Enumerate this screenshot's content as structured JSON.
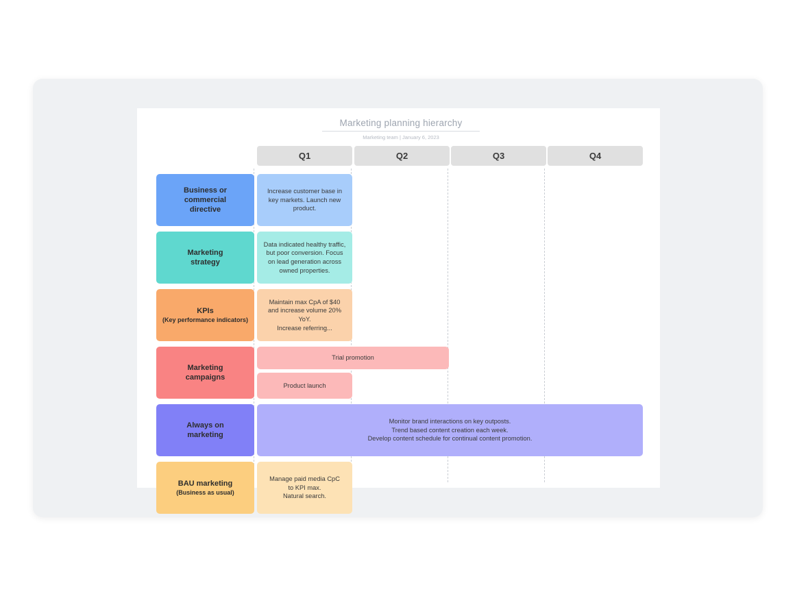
{
  "document": {
    "title": "Marketing planning hierarchy",
    "subtitle": "Marketing team  |  January 6, 2023"
  },
  "columns": [
    {
      "id": "q1",
      "label": "Q1"
    },
    {
      "id": "q2",
      "label": "Q2"
    },
    {
      "id": "q3",
      "label": "Q3"
    },
    {
      "id": "q4",
      "label": "Q4"
    }
  ],
  "rows": [
    {
      "id": "business-directive",
      "label": "Business or\ncommercial\ndirective",
      "sublabel": "",
      "color": "#6ba4f8",
      "cell_color": "#a8cdfb"
    },
    {
      "id": "marketing-strategy",
      "label": "Marketing\nstrategy",
      "sublabel": "",
      "color": "#5fd8cf",
      "cell_color": "#a5ece6"
    },
    {
      "id": "kpis",
      "label": "KPIs",
      "sublabel": "(Key performance indicators)",
      "color": "#f9a96a",
      "cell_color": "#fbd2ab"
    },
    {
      "id": "marketing-campaigns",
      "label": "Marketing\ncampaigns",
      "sublabel": "",
      "color": "#f98383",
      "cell_color": "#fcb9b9"
    },
    {
      "id": "always-on-marketing",
      "label": "Always on\nmarketing",
      "sublabel": "",
      "color": "#8180f7",
      "cell_color": "#b0affb"
    },
    {
      "id": "bau-marketing",
      "label": "BAU marketing",
      "sublabel": "(Business as usual)",
      "color": "#fcce7f",
      "cell_color": "#fde2b5"
    }
  ],
  "cells": {
    "business_directive_q1": "Increase customer base in key markets. Launch new product.",
    "marketing_strategy_q1": "Data indicated healthy traffic, but poor conversion. Focus on lead generation across owned properties.",
    "kpis_q1": "Maintain max CpA of $40 and increase volume 20% YoY.\nIncrease referring...",
    "campaign_trial_promotion": "Trial promotion",
    "campaign_product_launch": "Product launch",
    "always_on_all": "Monitor brand interactions on key outposts.\nTrend based content creation each week.\nDevelop content schedule for continual content promotion.",
    "bau_q1": "Manage paid media CpC\nto KPI max.\nNatural search."
  }
}
